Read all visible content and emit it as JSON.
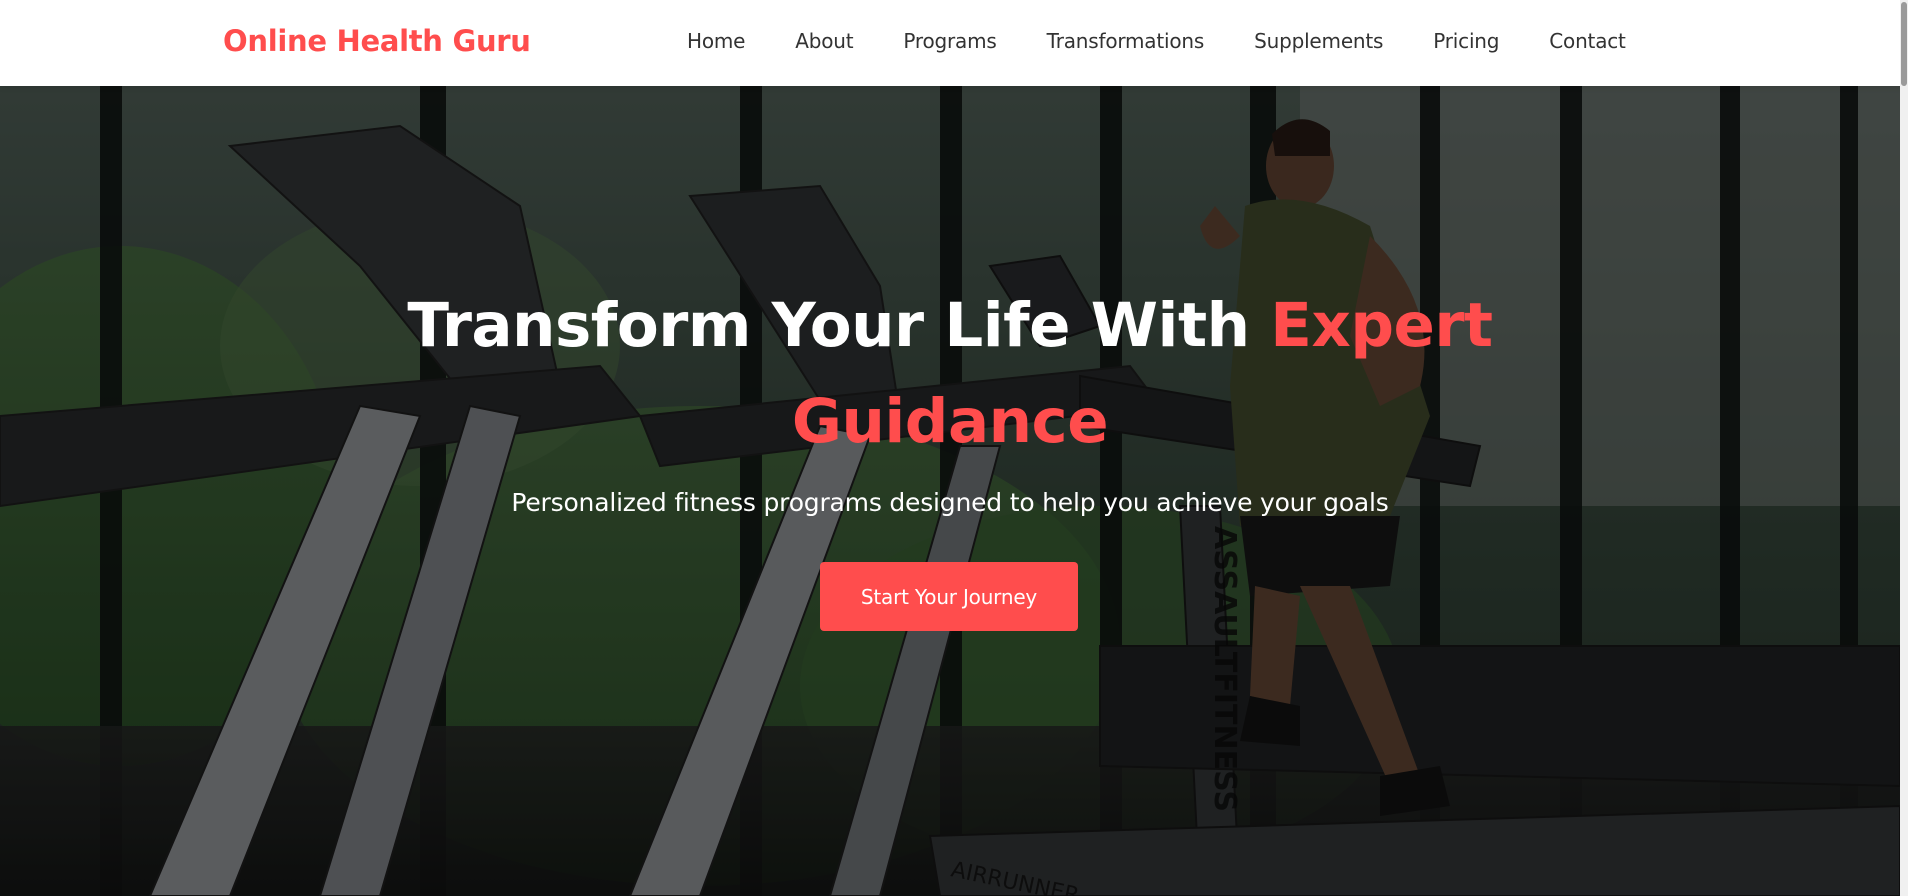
{
  "header": {
    "logo": "Online Health Guru",
    "nav": [
      {
        "label": "Home"
      },
      {
        "label": "About"
      },
      {
        "label": "Programs"
      },
      {
        "label": "Transformations"
      },
      {
        "label": "Supplements"
      },
      {
        "label": "Pricing"
      },
      {
        "label": "Contact"
      }
    ]
  },
  "hero": {
    "title_main": "Transform Your Life With ",
    "title_accent": "Expert Guidance",
    "subtitle": "Personalized fitness programs designed to help you achieve your goals",
    "cta_label": "Start Your Journey",
    "background_image": "gym-treadmill-runner-photo",
    "background_text": [
      "ASSAULTFITNESS",
      "AIRRUNNER"
    ]
  },
  "colors": {
    "accent": "#ff4d4d",
    "header_bg": "#ffffff",
    "nav_text": "#333333",
    "hero_text": "#ffffff"
  }
}
